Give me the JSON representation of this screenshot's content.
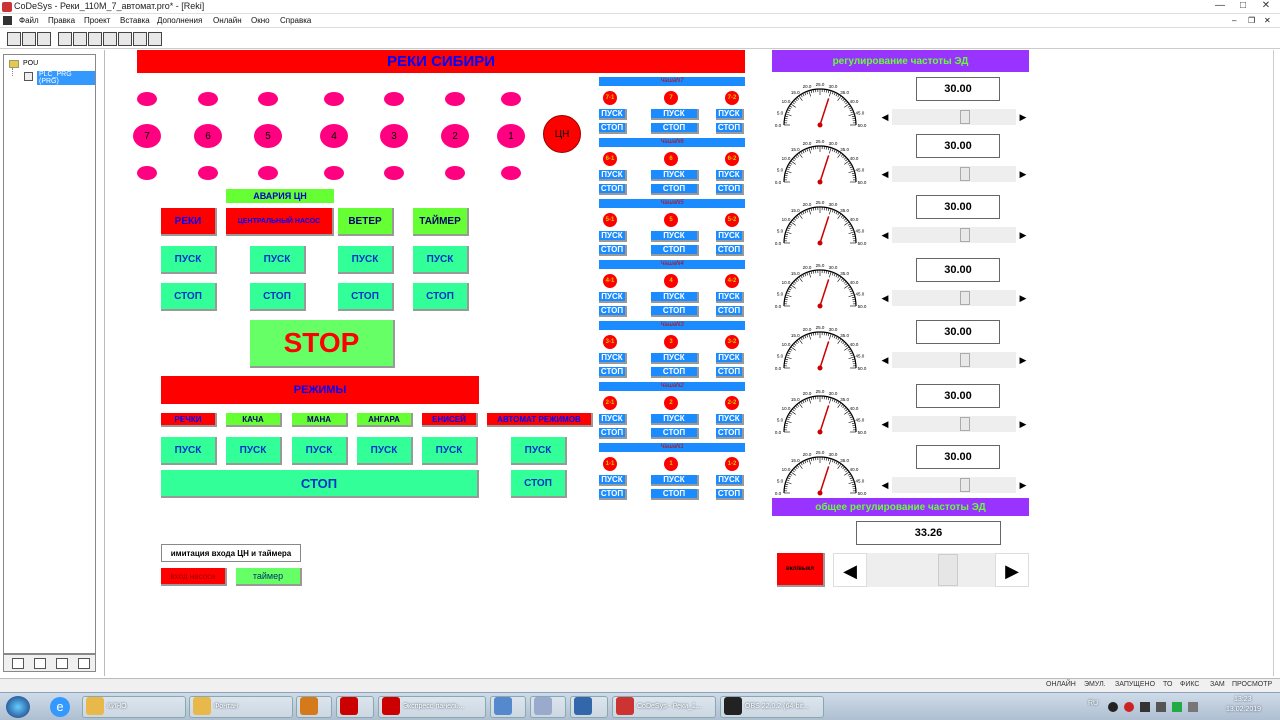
{
  "window": {
    "title": "CoDeSys - Реки_110M_7_автомат.pro* - [Reki]",
    "controls": [
      "—",
      "□",
      "✕"
    ]
  },
  "menu": [
    "Файл",
    "Правка",
    "Проект",
    "Вставка",
    "Дополнения",
    "Онлайн",
    "Окно",
    "Справка"
  ],
  "tree": {
    "root": "POU",
    "item": "PLC_PRG (PRG)"
  },
  "main": {
    "title": "РЕКИ СИБИРИ",
    "pump_label": "ЦН",
    "big_dots": [
      "7",
      "6",
      "5",
      "4",
      "3",
      "2",
      "1"
    ],
    "alarm": "АВАРИЯ ЦН",
    "units": [
      {
        "label": "РЕКИ",
        "start": "ПУСК",
        "stop": "СТОП"
      },
      {
        "label": "ЦЕНТРАЛЬНЫЙ НАСОС",
        "start": "ПУСК",
        "stop": "СТОП"
      },
      {
        "label": "ВЕТЕР",
        "start": "ПУСК",
        "stop": "СТОП"
      },
      {
        "label": "ТАЙМЕР",
        "start": "ПУСК",
        "stop": "СТОП"
      }
    ],
    "stop_big": "STOP",
    "modes_title": "РЕЖИМЫ",
    "modes": [
      "РЕЧКИ",
      "КАЧА",
      "МАНА",
      "АНГАРА",
      "ЕНИСЕЙ",
      "АВТОМАТ РЕЖИМОВ"
    ],
    "mode_start": "ПУСК",
    "modes_stop": "СТОП",
    "imitation_label": "имитация входа ЦН и таймера",
    "pump_input": "вход насоса",
    "timer": "таймер"
  },
  "sections": [
    {
      "title": "ЧашаN7",
      "dots": [
        "7-1",
        "7",
        "7-2"
      ]
    },
    {
      "title": "ЧашаN6",
      "dots": [
        "6-1",
        "6",
        "6-2"
      ]
    },
    {
      "title": "ЧашаN5",
      "dots": [
        "5-1",
        "5",
        "5-2"
      ]
    },
    {
      "title": "ЧашаN4",
      "dots": [
        "4-1",
        "4",
        "4-2"
      ]
    },
    {
      "title": "ЧашаN3",
      "dots": [
        "3-1",
        "3",
        "3-2"
      ]
    },
    {
      "title": "ЧашаN2",
      "dots": [
        "2-1",
        "2",
        "2-2"
      ]
    },
    {
      "title": "ЧашаN1",
      "dots": [
        "1-1",
        "1",
        "1-2"
      ]
    }
  ],
  "section_buttons": {
    "start": "ПУСК",
    "stop": "СТОП"
  },
  "freq": {
    "title": "регулирование частоты ЭД",
    "gauge_ticks": [
      "0.0",
      "5.0",
      "10.0",
      "15.0",
      "20.0",
      "25.0",
      "30.0",
      "35.0",
      "40.0",
      "45.0",
      "50.0"
    ],
    "values": [
      "30.00",
      "30.00",
      "30.00",
      "30.00",
      "30.00",
      "30.00",
      "30.00"
    ],
    "gauge_value": 30,
    "gauge_max": 50,
    "slider_position": 0.6,
    "common_title": "общее регулирование частоты ЭД",
    "common_value": "33.26",
    "common_button": "вкл/выкл",
    "common_slider_position": 0.66
  },
  "statusbar": [
    "ОНЛАЙН",
    "ЭМУЛ.",
    "ЗАПУЩЕНО",
    "ТО",
    "ФИКС",
    "ЗАМ",
    "ПРОСМОТР"
  ],
  "taskbar": [
    {
      "label": "КИНО",
      "color": "#e8b84a"
    },
    {
      "label": "Фонтан",
      "color": "#e8b84a"
    },
    {
      "label": "",
      "color": "#d47a1a"
    },
    {
      "label": "",
      "color": "#cc0000"
    },
    {
      "label": "Экспресс-панель...",
      "color": "#cc0000"
    },
    {
      "label": "",
      "color": "#5588cc"
    },
    {
      "label": "",
      "color": "#99aacc"
    },
    {
      "label": "",
      "color": "#3366aa"
    },
    {
      "label": "CoDeSys - Реки_1...",
      "color": "#cc3333"
    },
    {
      "label": "OBS 22.0.2 (64-bit...",
      "color": "#222"
    }
  ],
  "clock": {
    "lang": "RU",
    "time": "13:23",
    "date": "13.02.2019"
  },
  "colors": {
    "accent_purple": "#9933ff",
    "red": "#ff0000",
    "green": "#33ff99",
    "blue": "#1a8cff",
    "pink": "#ff0080"
  }
}
